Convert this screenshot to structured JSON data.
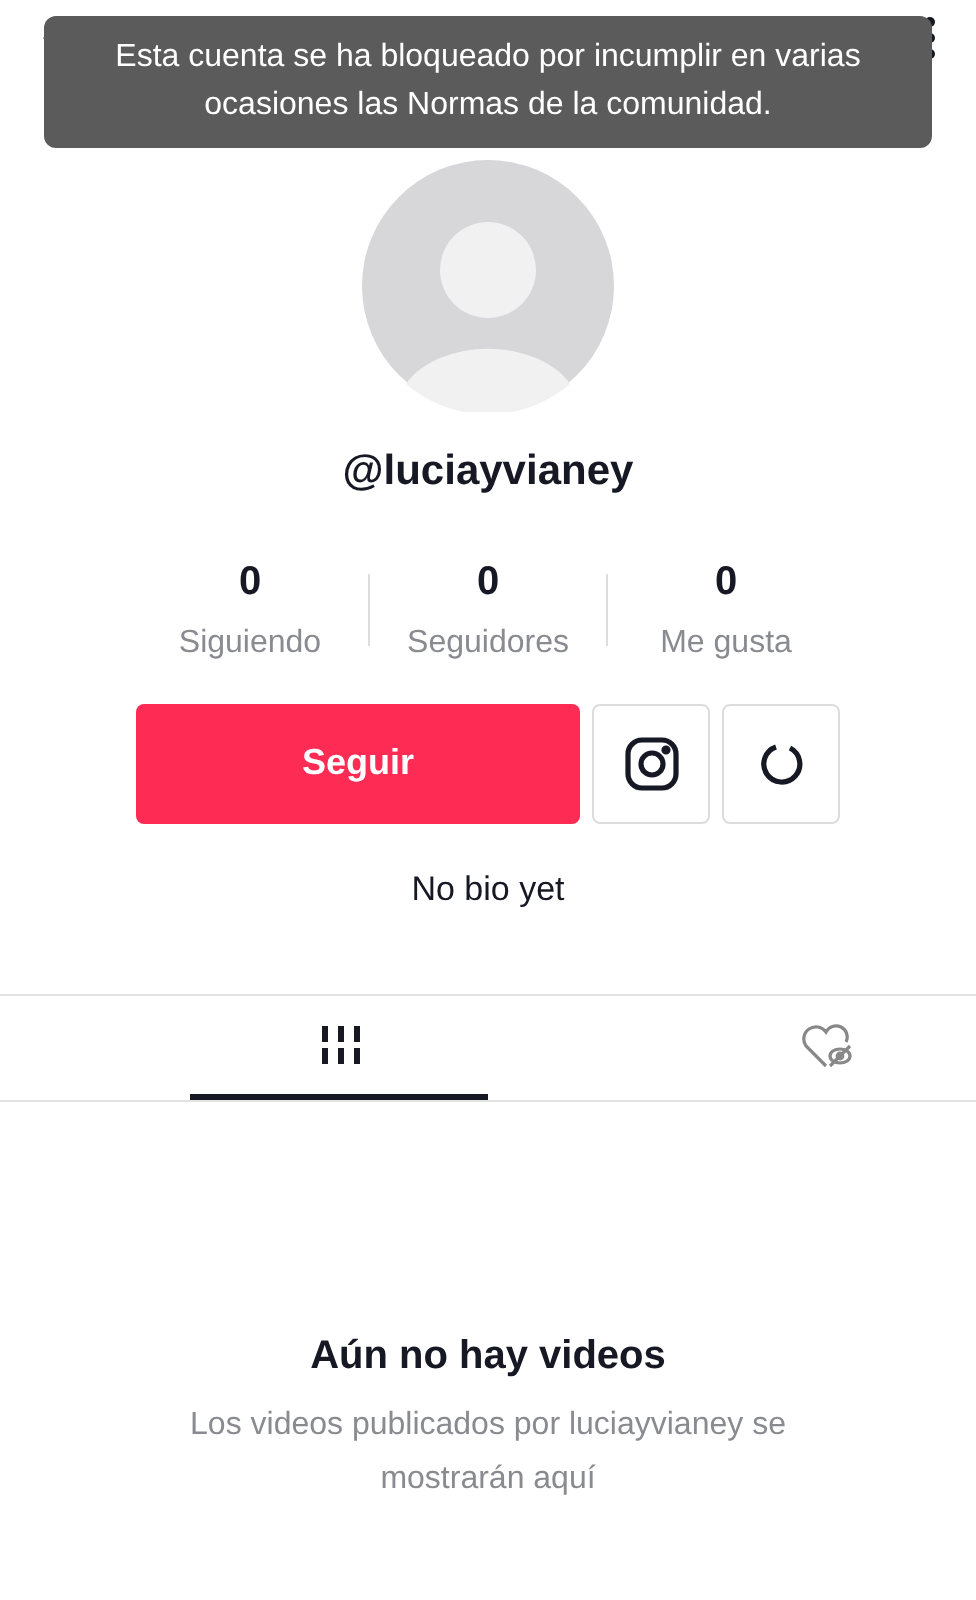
{
  "toast": {
    "message": "Esta cuenta se ha bloqueado por incumplir en varias ocasiones las Normas de la comunidad."
  },
  "profile": {
    "username": "@luciayvianey"
  },
  "stats": [
    {
      "value": "0",
      "label": "Siguiendo"
    },
    {
      "value": "0",
      "label": "Seguidores"
    },
    {
      "value": "0",
      "label": "Me gusta"
    }
  ],
  "follow_button": "Seguir",
  "bio": "No bio yet",
  "tabs": [
    {
      "kind": "videos",
      "selected": true
    },
    {
      "kind": "liked",
      "selected": false
    }
  ],
  "empty_state": {
    "title": "Aún no hay videos",
    "message": "Los videos publicados por luciayvianey se mostrarán aquí"
  }
}
